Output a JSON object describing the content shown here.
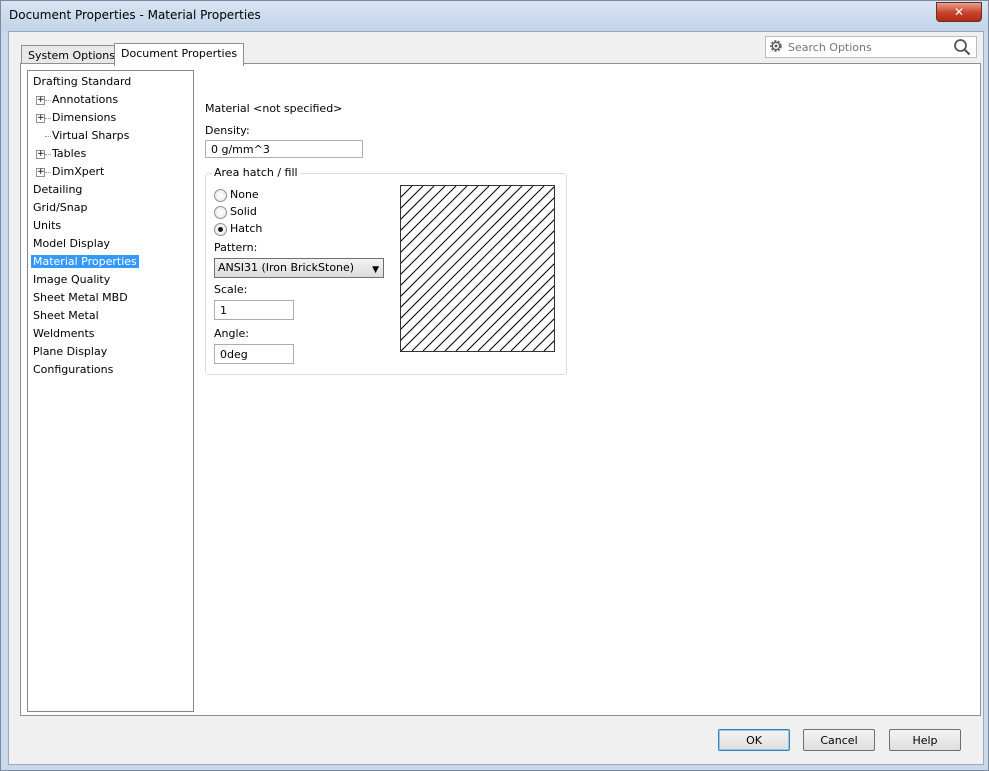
{
  "window": {
    "title": "Document Properties - Material Properties"
  },
  "tabs": [
    {
      "label": "System Options"
    },
    {
      "label": "Document Properties"
    }
  ],
  "search": {
    "placeholder": "Search Options"
  },
  "tree": {
    "items": [
      {
        "label": "Drafting Standard"
      },
      {
        "label": "Annotations"
      },
      {
        "label": "Dimensions"
      },
      {
        "label": "Virtual Sharps"
      },
      {
        "label": "Tables"
      },
      {
        "label": "DimXpert"
      },
      {
        "label": "Detailing"
      },
      {
        "label": "Grid/Snap"
      },
      {
        "label": "Units"
      },
      {
        "label": "Model Display"
      },
      {
        "label": "Material Properties"
      },
      {
        "label": "Image Quality"
      },
      {
        "label": "Sheet Metal MBD"
      },
      {
        "label": "Sheet Metal"
      },
      {
        "label": "Weldments"
      },
      {
        "label": "Plane Display"
      },
      {
        "label": "Configurations"
      }
    ]
  },
  "material": {
    "header": "Material <not specified>",
    "density_label": "Density:",
    "density_value": "0 g/mm^3"
  },
  "hatch": {
    "group_title": "Area hatch / fill",
    "options": [
      {
        "label": "None"
      },
      {
        "label": "Solid"
      },
      {
        "label": "Hatch"
      }
    ],
    "selected_option": "Hatch",
    "pattern_label": "Pattern:",
    "pattern_value": "ANSI31 (Iron BrickStone)",
    "scale_label": "Scale:",
    "scale_value": "1",
    "angle_label": "Angle:",
    "angle_value": "0deg"
  },
  "buttons": {
    "ok": "OK",
    "cancel": "Cancel",
    "help": "Help"
  },
  "icons": {
    "close": "close-icon",
    "search": "search-icon",
    "settings": "gear-icon"
  }
}
